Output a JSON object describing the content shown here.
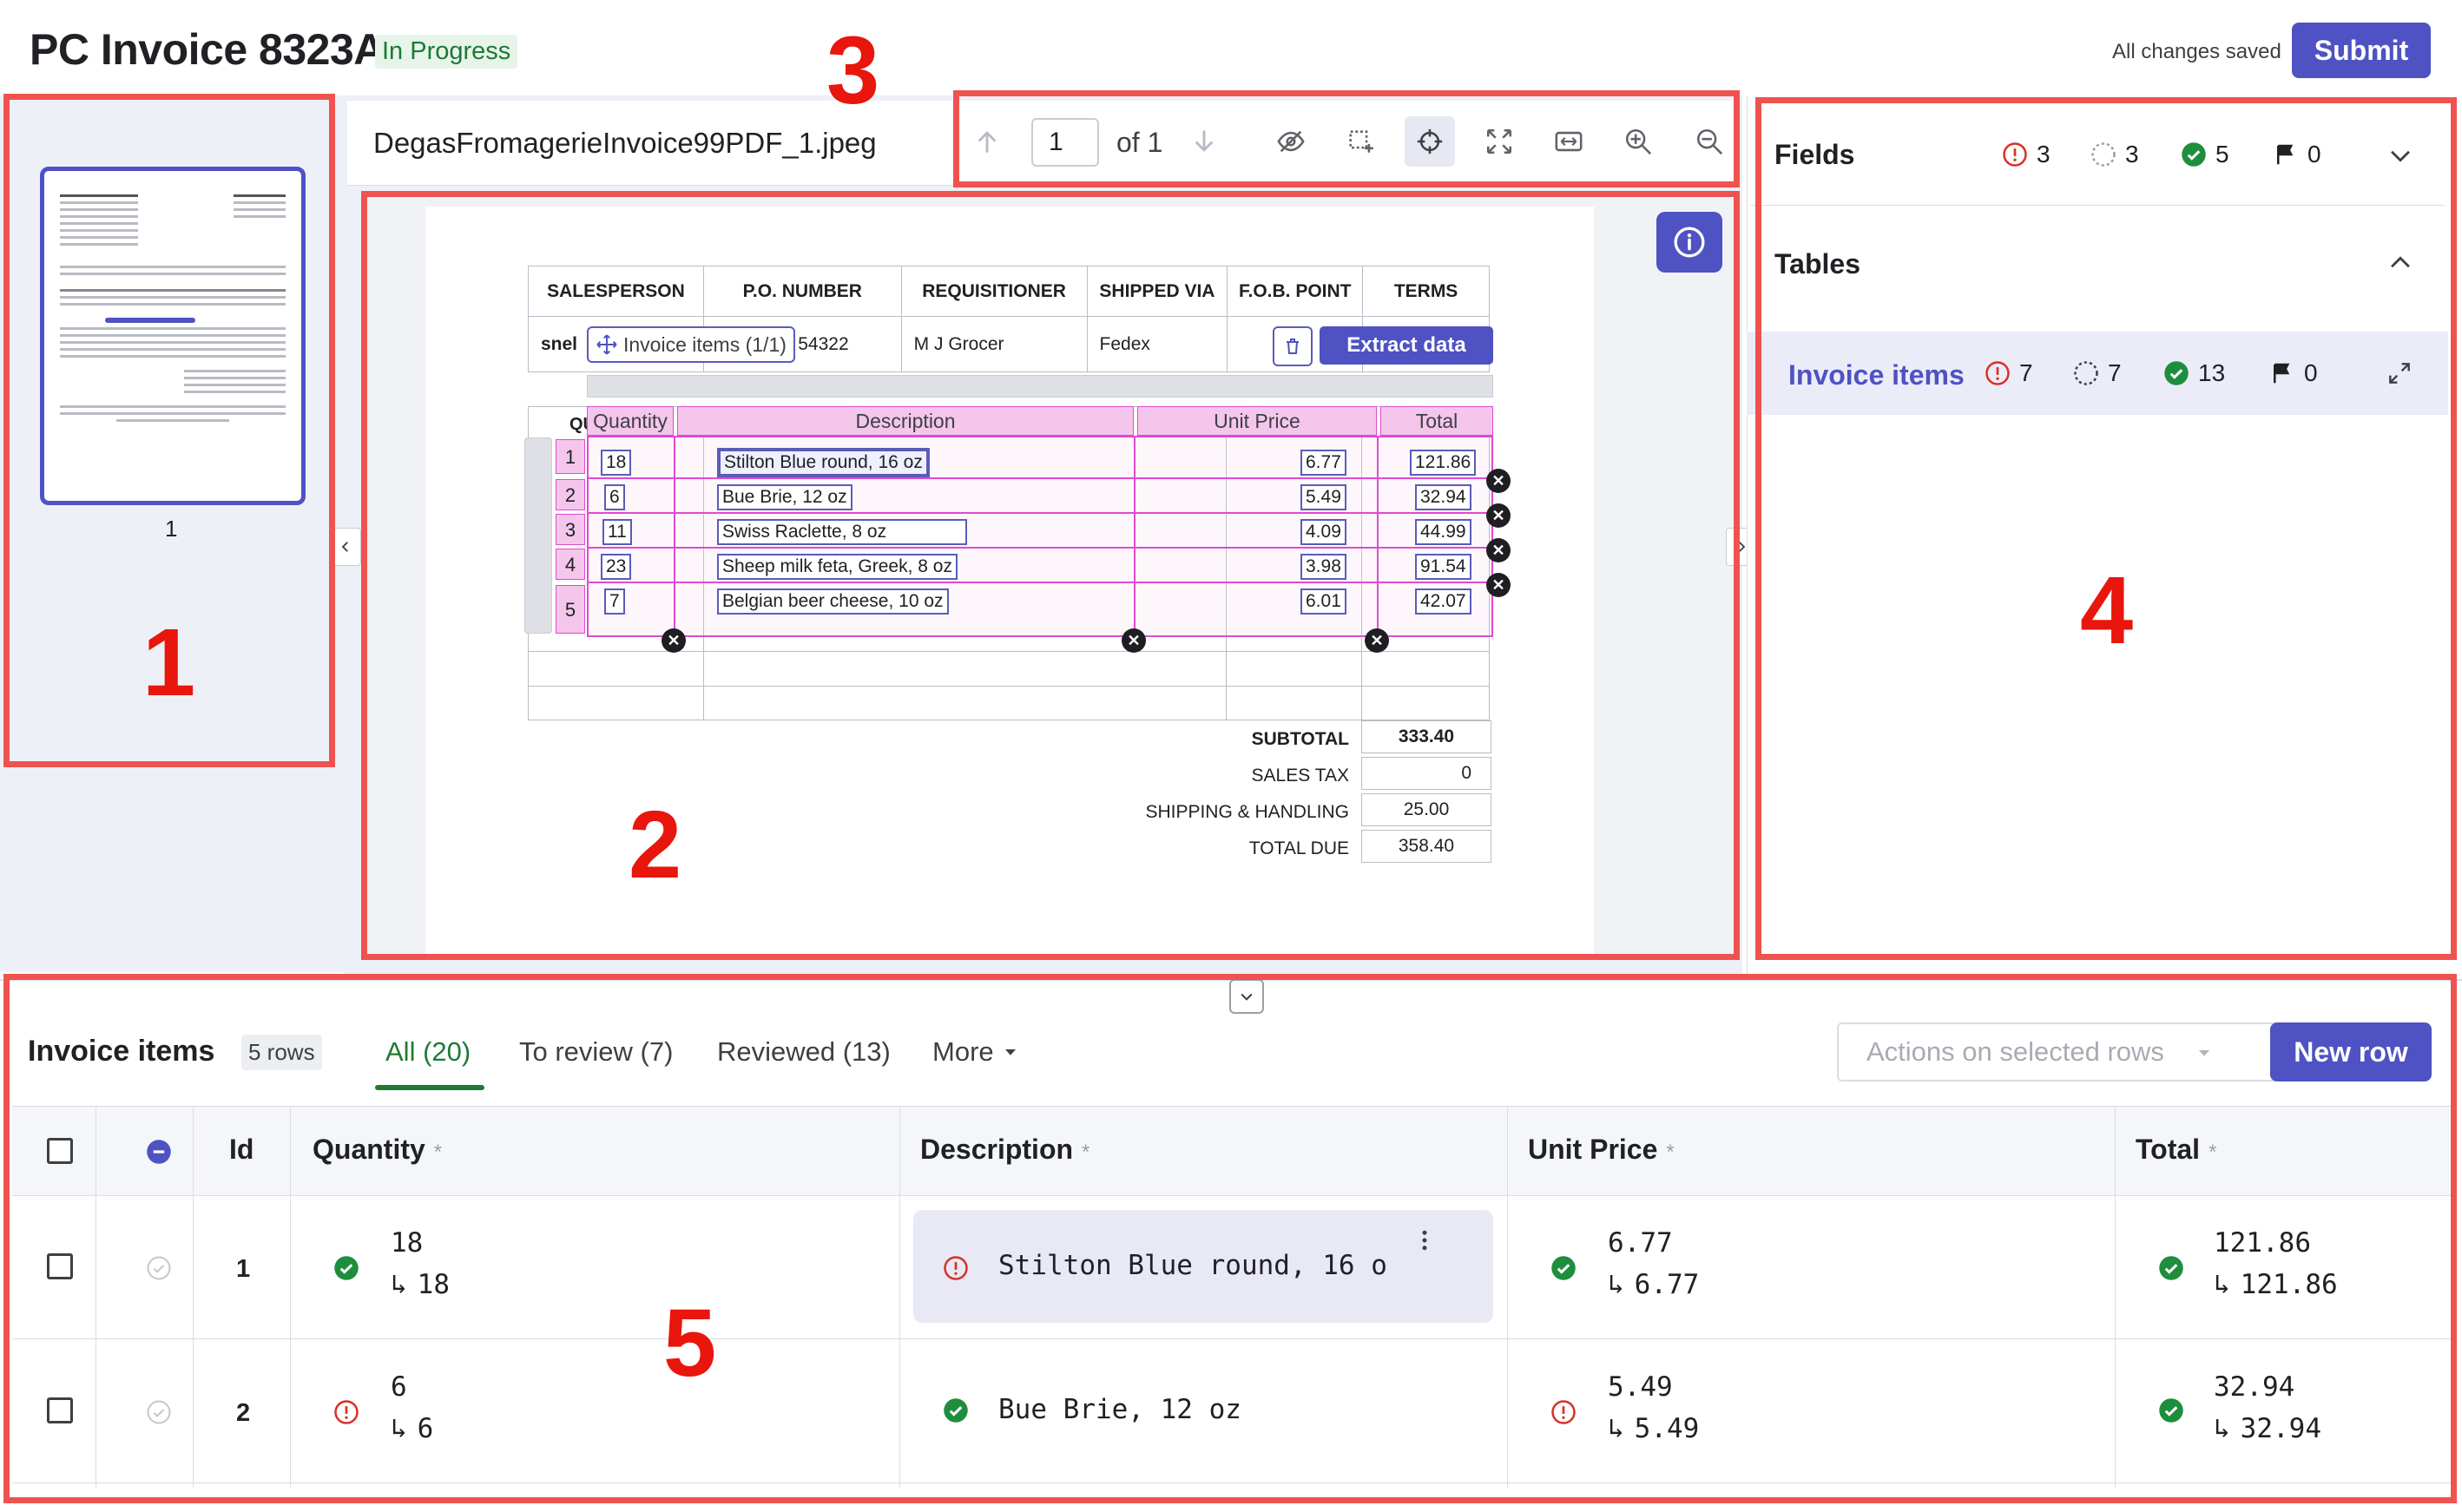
{
  "header": {
    "title": "PC Invoice 8323A",
    "status": "In Progress",
    "saved": "All changes saved",
    "submit": "Submit"
  },
  "thumbs": {
    "page_label": "1"
  },
  "viewer": {
    "file_name": "DegasFromagerieInvoice99PDF_1.jpeg",
    "page_current": "1",
    "page_of": "of 1",
    "toolbar_icons": [
      "arrow-up-icon",
      "arrow-down-icon",
      "eye-off-icon",
      "box-select-icon",
      "crosshair-icon",
      "fit-page-icon",
      "fit-width-icon",
      "zoom-in-icon",
      "zoom-out-icon"
    ]
  },
  "doc": {
    "header_cols": [
      "SALESPERSON",
      "P.O. NUMBER",
      "REQUISITIONER",
      "SHIPPED VIA",
      "F.O.B. POINT",
      "TERMS"
    ],
    "header_vals": [
      "snel",
      "54322",
      "M J Grocer",
      "Fedex",
      "",
      ""
    ],
    "overlay_label": "Invoice items (1/1)",
    "extract_label": "Extract data",
    "partial_q": "QU",
    "cols": [
      "Quantity",
      "Description",
      "Unit Price",
      "Total"
    ],
    "rows": [
      {
        "n": "1",
        "q": "18",
        "d": "Stilton Blue round, 16 oz",
        "u": "6.77",
        "t": "121.86"
      },
      {
        "n": "2",
        "q": "6",
        "d": "Bue Brie, 12 oz",
        "u": "5.49",
        "t": "32.94"
      },
      {
        "n": "3",
        "q": "11",
        "d": "Swiss Raclette, 8 oz",
        "u": "4.09",
        "t": "44.99"
      },
      {
        "n": "4",
        "q": "23",
        "d": "Sheep milk feta, Greek, 8 oz",
        "u": "3.98",
        "t": "91.54"
      },
      {
        "n": "5",
        "q": "7",
        "d": "Belgian beer cheese, 10 oz",
        "u": "6.01",
        "t": "42.07"
      }
    ],
    "totals": [
      {
        "label": "SUBTOTAL",
        "value": "333.40"
      },
      {
        "label": "SALES TAX",
        "value": "0"
      },
      {
        "label": "SHIPPING & HANDLING",
        "value": "25.00"
      },
      {
        "label": "TOTAL DUE",
        "value": "358.40"
      }
    ]
  },
  "right": {
    "fields_title": "Fields",
    "fields_counts": {
      "error": "3",
      "pending": "3",
      "ok": "5",
      "flag": "0"
    },
    "tables_title": "Tables",
    "table_name": "Invoice items",
    "table_counts": {
      "error": "7",
      "pending": "7",
      "ok": "13",
      "flag": "0"
    }
  },
  "bottom": {
    "title": "Invoice items",
    "rows_badge": "5 rows",
    "tabs": [
      "All (20)",
      "To review (7)",
      "Reviewed (13)",
      "More"
    ],
    "actions": "Actions on selected rows",
    "new_row": "New row",
    "cols": [
      "Id",
      "Quantity",
      "Description",
      "Unit Price",
      "Total"
    ],
    "asterisk": "*",
    "rows": [
      {
        "id": "1",
        "q": "18",
        "q2": "18",
        "d": "Stilton Blue round, 16 o",
        "u": "6.77",
        "u2": "6.77",
        "t": "121.86",
        "t2": "121.86"
      },
      {
        "id": "2",
        "q": "6",
        "q2": "6",
        "d": "Bue Brie, 12 oz",
        "u": "5.49",
        "u2": "5.49",
        "t": "32.94",
        "t2": "32.94"
      }
    ]
  },
  "annotations": [
    "1",
    "2",
    "3",
    "4",
    "5"
  ],
  "colors": {
    "accent": "#4e52c3",
    "ok": "#1e8e3e",
    "error": "#d93025",
    "annotation": "#ef5350",
    "overlay": "#e04ad1"
  }
}
